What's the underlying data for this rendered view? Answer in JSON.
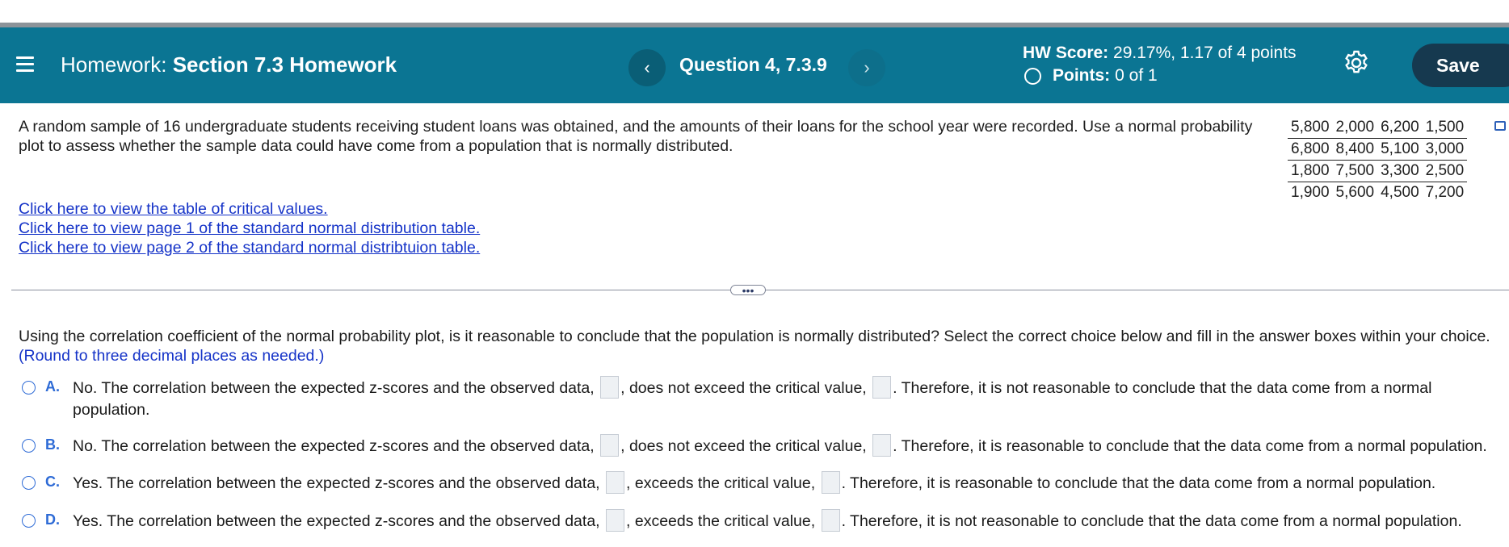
{
  "header": {
    "title_prefix": "Homework:",
    "title": "Section 7.3 Homework",
    "prev_label": "‹",
    "question_label": "Question 4, 7.3.9",
    "next_label": "›",
    "score_label": "HW Score:",
    "score_value": "29.17%, 1.17 of 4 points",
    "points_label": "Points:",
    "points_value": "0 of 1",
    "save_label": "Save"
  },
  "problem": {
    "text": "A random sample of 16 undergraduate students receiving student loans was obtained, and the amounts of their loans for the school year were recorded. Use a normal probability plot to assess whether the sample data could have come from a population that is normally distributed."
  },
  "data_table": [
    [
      "5,800",
      "2,000",
      "6,200",
      "1,500"
    ],
    [
      "6,800",
      "8,400",
      "5,100",
      "3,000"
    ],
    [
      "1,800",
      "7,500",
      "3,300",
      "2,500"
    ],
    [
      "1,900",
      "5,600",
      "4,500",
      "7,200"
    ]
  ],
  "links": [
    "Click here to view the table of critical values.",
    "Click here to view page 1 of the standard normal distribution table.",
    "Click here to view page 2 of the standard normal distribtuion table."
  ],
  "more_label": "•••",
  "question": {
    "text": "Using the correlation coefficient of the normal probability plot, is it reasonable to conclude that the population is normally distributed? Select the correct choice below and fill in the answer boxes within your choice.",
    "instruction": "(Round to three decimal places as needed.)"
  },
  "choices": [
    {
      "letter": "A.",
      "part1": "No. The correlation between the expected z-scores and the observed data,",
      "part2": ", does not exceed the critical value,",
      "part3": ". Therefore, it is not reasonable to conclude that the data come from a normal",
      "cont": "population."
    },
    {
      "letter": "B.",
      "part1": "No. The correlation between the expected z-scores and the observed data,",
      "part2": ", does not exceed the critical value,",
      "part3": ". Therefore, it is reasonable to conclude that the data come from a normal population."
    },
    {
      "letter": "C.",
      "part1": "Yes. The correlation between the expected z-scores and the observed data,",
      "part2": ", exceeds the critical value,",
      "part3": ". Therefore, it is reasonable to conclude that the data come from a normal population."
    },
    {
      "letter": "D.",
      "part1": "Yes. The correlation between the expected z-scores and the observed data,",
      "part2": ", exceeds the critical value,",
      "part3": ". Therefore, it is not reasonable to conclude that the data come from a normal population."
    }
  ]
}
